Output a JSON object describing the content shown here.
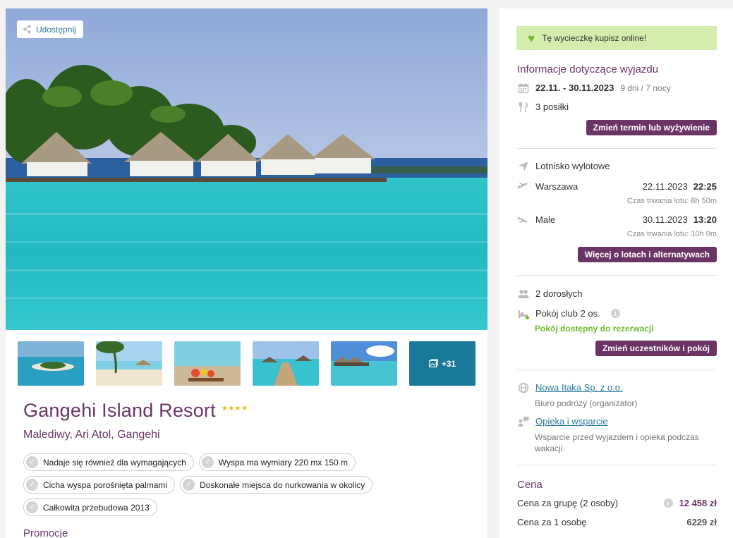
{
  "gallery": {
    "share_label": "Udostępnij",
    "more_count": "+31"
  },
  "hotel": {
    "name": "Gangehi Island Resort",
    "stars": "★★★★",
    "location": "Malediwy, Ari Atol, Gangehi",
    "tags": [
      [
        "Nadaje się również dla wymagających",
        "Wyspa ma wymiary 220 mx 150 m"
      ],
      [
        "Cicha wyspa porośnięta palmami",
        "Doskonałe miejsca do nurkowania w okolicy"
      ],
      [
        "Całkowita przebudowa 2013"
      ]
    ],
    "promo_heading": "Promocje"
  },
  "sidebar": {
    "online_notice": "Tę wycieczkę kupisz online!",
    "trip_info_title": "Informacje dotyczące wyjazdu",
    "dates": "22.11. - 30.11.2023",
    "duration": "9 dni / 7 nocy",
    "meals": "3 posiłki",
    "change_date_button": "Zmień termin lub wyżywienie",
    "airport_label": "Lotnisko wylotowe",
    "outbound": {
      "city": "Warszawa",
      "date": "22.11.2023",
      "time": "22:25",
      "duration": "Czas trwania lotu: 8h 50m"
    },
    "inbound": {
      "city": "Male",
      "date": "30.11.2023",
      "time": "13:20",
      "duration": "Czas trwania lotu: 10h 0m"
    },
    "flights_button": "Więcej o lotach i alternatywach",
    "travellers": "2 dorosłych",
    "room": "Pokój club 2 os.",
    "room_status": "Pokój dostępny do rezerwacji",
    "change_people_button": "Zmień uczestników i pokój",
    "organizer_link": "Nowa Itaka Sp. z o.o.",
    "organizer_desc": "Biuro podróży (organizator)",
    "support_link": "Opieka i wsparcie",
    "support_desc_1": "Wsparcie przed wyjazdem i opieka podczas",
    "support_desc_2": "wakacji.",
    "price_title": "Cena",
    "price_group_label": "Cena za grupę (2 osoby)",
    "price_group_value": "12 458 zł",
    "price_person_label": "Cena za 1 osobę",
    "price_person_value": "6229 zł"
  },
  "colors": {
    "accent_purple": "#6b3467",
    "green": "#6dbb2b",
    "link_blue": "#2a7aa0"
  }
}
